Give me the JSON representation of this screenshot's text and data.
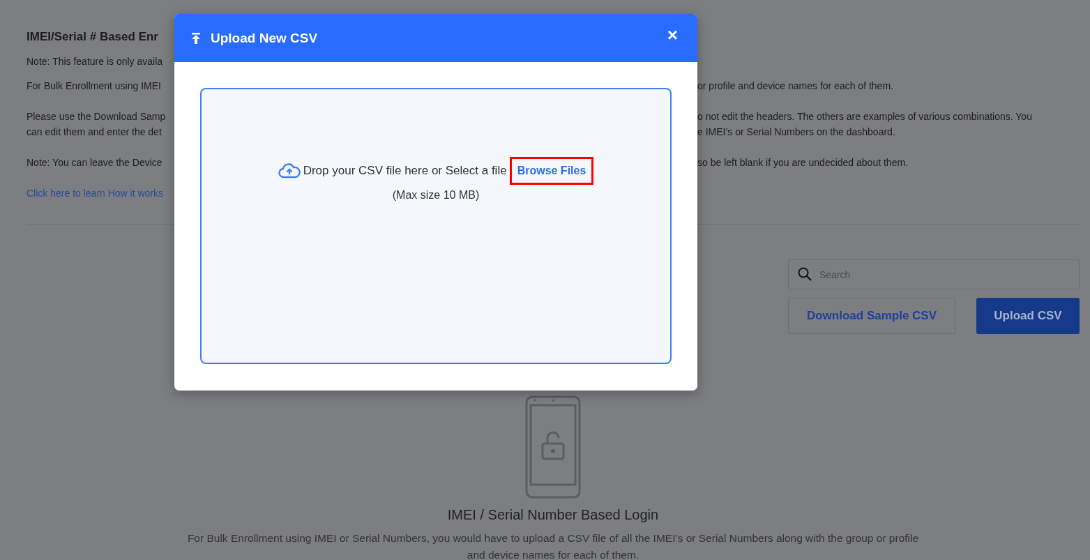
{
  "page": {
    "heading": "IMEI/Serial # Based Enr",
    "rows": [
      {
        "left": "Note: This feature is only availa"
      },
      {
        "left": "For Bulk Enrollment using IMEI",
        "right": "or profile and device names for each of them."
      },
      {
        "left": "Please use the Download Samp",
        "right": "o not edit the headers. The others are examples of various combinations. You"
      },
      {
        "left": "can edit them and enter the det",
        "right": "e IMEI’s or Serial Numbers on the dashboard."
      },
      {
        "left": "Note: You can leave the Device",
        "right": "so be left blank if you are undecided about them."
      }
    ],
    "link": "Click here to learn How it works",
    "search": {
      "placeholder": "Search"
    },
    "buttons": [
      "Download Sample CSV",
      "Upload CSV"
    ],
    "empty_title": "IMEI / Serial Number Based Login",
    "empty_text": "For Bulk Enrollment using IMEI or Serial Numbers, you would have to upload a CSV file of all the IMEI’s or Serial Numbers along with the group or profile and device names for each of them."
  },
  "modal": {
    "title": "Upload New CSV",
    "close": "×",
    "drop_text": "Drop your CSV file here or Select a file",
    "browse": "Browse Files",
    "browse_highlighted": true,
    "max_size": "(Max size 10 MB)"
  }
}
